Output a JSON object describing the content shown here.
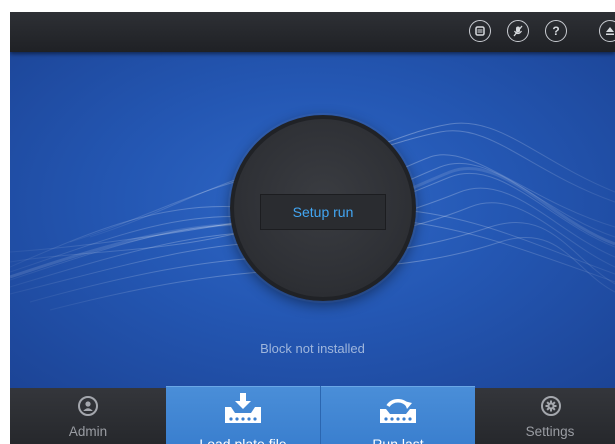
{
  "colors": {
    "main_blue": "#2457b3",
    "setup_text": "#42a6f3",
    "button_blue": "#3a7fcf",
    "bar_dark": "#2a2c30"
  },
  "topbar": {
    "icons": [
      "stop-icon",
      "mic-muted-icon",
      "help-icon",
      "eject-icon"
    ],
    "help_glyph": "?"
  },
  "main": {
    "setup_label": "Setup run",
    "status": "Block not installed"
  },
  "bottombar": {
    "admin_label": "Admin",
    "load_plate_label": "Load plate file",
    "run_last_label": "Run last",
    "settings_label": "Settings"
  }
}
